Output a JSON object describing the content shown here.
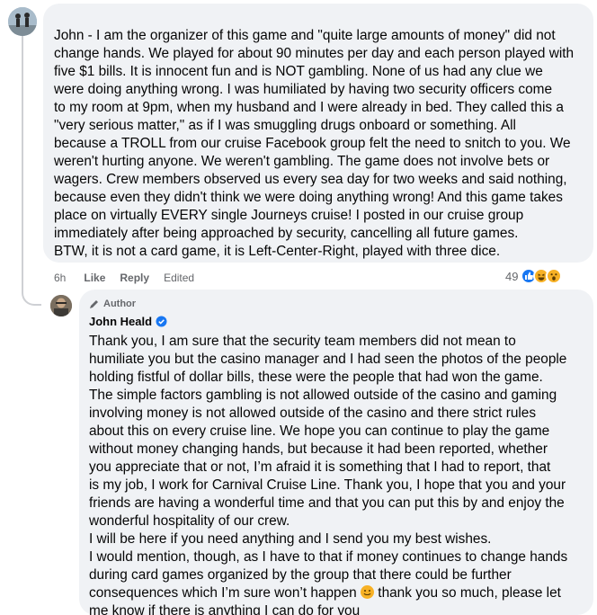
{
  "comment": {
    "text": "John - I am the organizer of this game and \"quite large amounts of money\" did not\nchange hands. We played for about 90 minutes per day and each person played with\nfive $1 bills. It is innocent fun and is NOT gambling. None of us had any clue we\nwere doing anything wrong. I was humiliated by having two security officers come\nto my room at 9pm, when my husband and I were already in bed. They called this a\n\"very serious matter,\" as if I was smuggling drugs onboard or something. All\nbecause a TROLL from our cruise Facebook group felt the need to snitch to you. We\nweren't hurting anyone. We weren't gambling. The game does not involve bets or\nwagers. Crew members observed us every sea day for two weeks and said nothing,\nbecause even they didn't think we were doing anything wrong! And this game takes\nplace on virtually EVERY single Journeys cruise! I posted in our cruise group\nimmediately after being approached by security, cancelling all future games.\nBTW, it is not a card game, it is Left-Center-Right, played with three dice.",
    "time": "6h",
    "like_label": "Like",
    "reply_label": "Reply",
    "edited_label": "Edited",
    "reaction_count": "49",
    "reactions": [
      "like-icon",
      "haha-icon",
      "wow-icon"
    ]
  },
  "reply": {
    "badge": "Author",
    "author": "John Heald",
    "verified_icon": "verified-badge-icon",
    "text_before_emoji": "Thank you, I am sure that the security team members did not mean to\nhumiliate you but the casino manager and I had seen the photos of the people\nholding fistful of dollar bills, these were the people that had won the game.\nThe simple factors gambling is not allowed outside of the casino and gaming\ninvolving money is not allowed outside of the casino and there strict rules\nabout this on every cruise line. We hope you can continue to play the game\nwithout money changing hands, but because it had been reported, whether\nyou appreciate that or not, I’m afraid it is something that I had to report, that\nis my job, I work for Carnival Cruise Line. Thank you, I hope that you and your\nfriends are having a wonderful time and that you can put this by and enjoy the\nwonderful hospitality of our crew.\nI will be here if you need anything and I send you my best wishes.\nI would mention, though, as I have to that if money continues to change hands\nduring card games organized by the group that there could be further\nconsequences which I’m sure won’t happen",
    "emoji_icon": "smiley-emoji-icon",
    "text_after_emoji": " thank you so much, please let\nme know if there is anything I can do for you"
  },
  "colors": {
    "bubble": "#f0f2f5",
    "meta": "#65676b",
    "like_blue": "#1877f2",
    "emoji_yellow": "#f7b125"
  }
}
